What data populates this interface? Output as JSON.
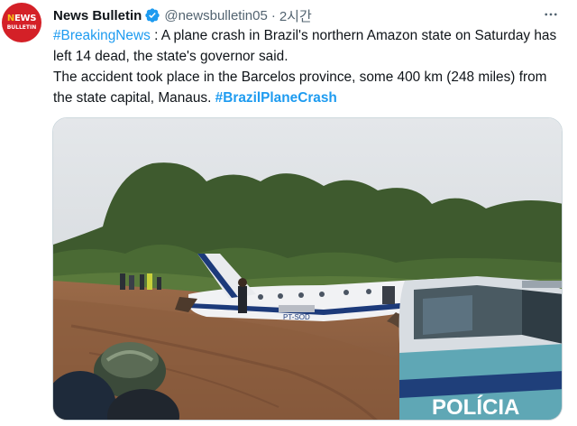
{
  "account": {
    "avatar_line1_accent": "N",
    "avatar_line1_rest": "EWS",
    "avatar_line2": "BULLETIN",
    "display_name": "News Bulletin",
    "handle": "@newsbulletin05",
    "separator": "·",
    "time": "2시간"
  },
  "tweet": {
    "hashtag_breaking": "#BreakingNews",
    "line1_rest": " : A plane crash in Brazil's northern Amazon state on Saturday has left 14 dead, the state's governor said.",
    "line2": "The accident took place in the Barcelos province, some 400 km (248 miles) from the state capital, Manaus. ",
    "hashtag_crash": "#BrazilPlaneCrash"
  },
  "media": {
    "plane_registration": "PT-SOD",
    "police_text": "POLÍCIA"
  },
  "colors": {
    "link": "#1d9bf0",
    "verified": "#1d9bf0",
    "avatar_bg": "#d42027",
    "text_secondary": "#536471"
  },
  "icons": {
    "verified": "verified-badge-icon",
    "more": "more-options-icon"
  }
}
